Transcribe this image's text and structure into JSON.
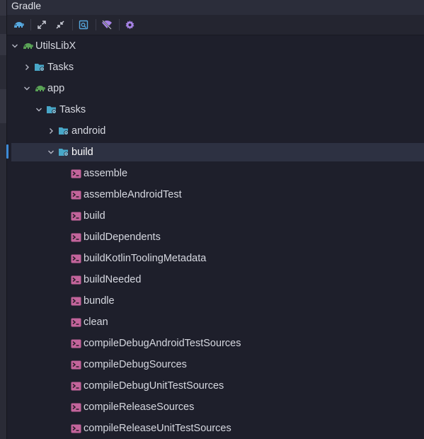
{
  "panel": {
    "title": "Gradle"
  },
  "toolbar": {
    "buttons": [
      {
        "name": "gradle-sync-button",
        "icon": "elephant-icon"
      },
      {
        "name": "expand-all-button",
        "icon": "expand-icon"
      },
      {
        "name": "collapse-all-button",
        "icon": "collapse-icon"
      },
      {
        "name": "analyze-dependencies-button",
        "icon": "search-document-icon"
      },
      {
        "name": "toggle-offline-button",
        "icon": "offline-icon"
      },
      {
        "name": "settings-button",
        "icon": "gear-icon"
      }
    ]
  },
  "colors": {
    "background": "#1e1f2b",
    "selected_row": "#2d3142",
    "gradle_green": "#5aa356",
    "folder_teal": "#48a7c8",
    "task_magenta": "#c3649b",
    "toolbar_blue": "#56a8df",
    "toolbar_purple": "#a783e6"
  },
  "tree": {
    "root": {
      "label": "UtilsLibX",
      "icon": "gradle-elephant-icon",
      "expanded": true
    },
    "root_tasks": {
      "label": "Tasks",
      "icon": "tasks-folder-icon",
      "expanded": false
    },
    "app": {
      "label": "app",
      "icon": "gradle-elephant-icon",
      "expanded": true
    },
    "app_tasks": {
      "label": "Tasks",
      "icon": "tasks-folder-icon",
      "expanded": true
    },
    "android_group": {
      "label": "android",
      "icon": "tasks-folder-icon",
      "expanded": false
    },
    "build_group": {
      "label": "build",
      "icon": "tasks-folder-icon",
      "expanded": true,
      "selected": true
    },
    "build_tasks": [
      "assemble",
      "assembleAndroidTest",
      "build",
      "buildDependents",
      "buildKotlinToolingMetadata",
      "buildNeeded",
      "bundle",
      "clean",
      "compileDebugAndroidTestSources",
      "compileDebugSources",
      "compileDebugUnitTestSources",
      "compileReleaseSources",
      "compileReleaseUnitTestSources"
    ]
  }
}
